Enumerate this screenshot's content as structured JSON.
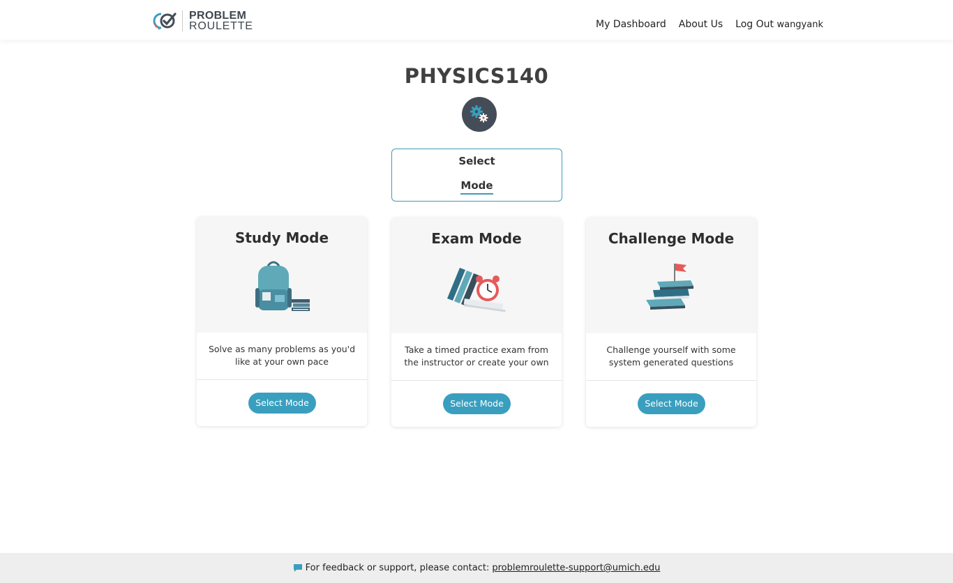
{
  "header": {
    "logo_line1": "PROBLEM",
    "logo_line2": "ROULETTE",
    "nav": {
      "dashboard": "My Dashboard",
      "about": "About Us",
      "logout": "Log Out",
      "username": "wangyank"
    }
  },
  "course": {
    "title": "PHYSICS140",
    "select_line1": "Select",
    "select_line2": "Mode"
  },
  "cards": [
    {
      "title": "Study Mode",
      "description": "Solve as many problems as you'd like at your own pace",
      "button": "Select Mode",
      "icon": "backpack-books-icon"
    },
    {
      "title": "Exam Mode",
      "description": "Take a timed practice exam from the instructor or create your own",
      "button": "Select Mode",
      "icon": "books-alarm-clock-icon"
    },
    {
      "title": "Challenge Mode",
      "description": "Challenge yourself with some system generated questions",
      "button": "Select Mode",
      "icon": "book-stack-flag-icon"
    }
  ],
  "footer": {
    "text": "For feedback or support, please contact:",
    "email": "problemroulette-support@umich.edu"
  },
  "colors": {
    "accent": "#3a9fbf",
    "settings_bg": "#444d57",
    "footer_bg": "#eeeeee"
  }
}
